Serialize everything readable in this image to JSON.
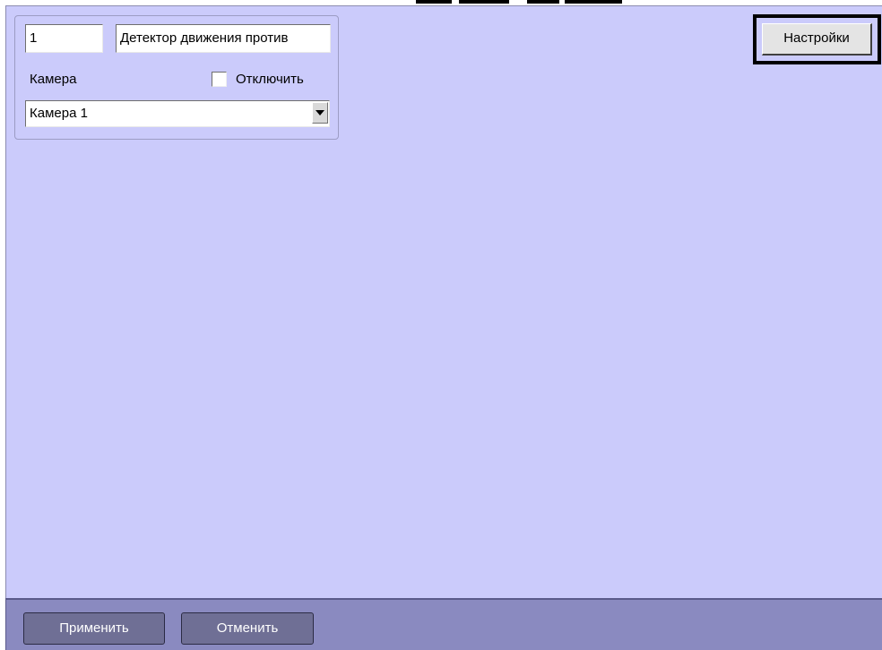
{
  "object": {
    "id_value": "1",
    "name_value": "Детектор движения против",
    "camera_label": "Камера",
    "disable_label": "Отключить",
    "disable_checked": false,
    "camera_selected": "Камера 1"
  },
  "toolbar": {
    "settings_label": "Настройки"
  },
  "footer": {
    "apply_label": "Применить",
    "cancel_label": "Отменить"
  },
  "colors": {
    "panel_background": "#cbcbfb",
    "bottom_bar": "#8a8ac0",
    "bar_button": "#6f6f95"
  }
}
